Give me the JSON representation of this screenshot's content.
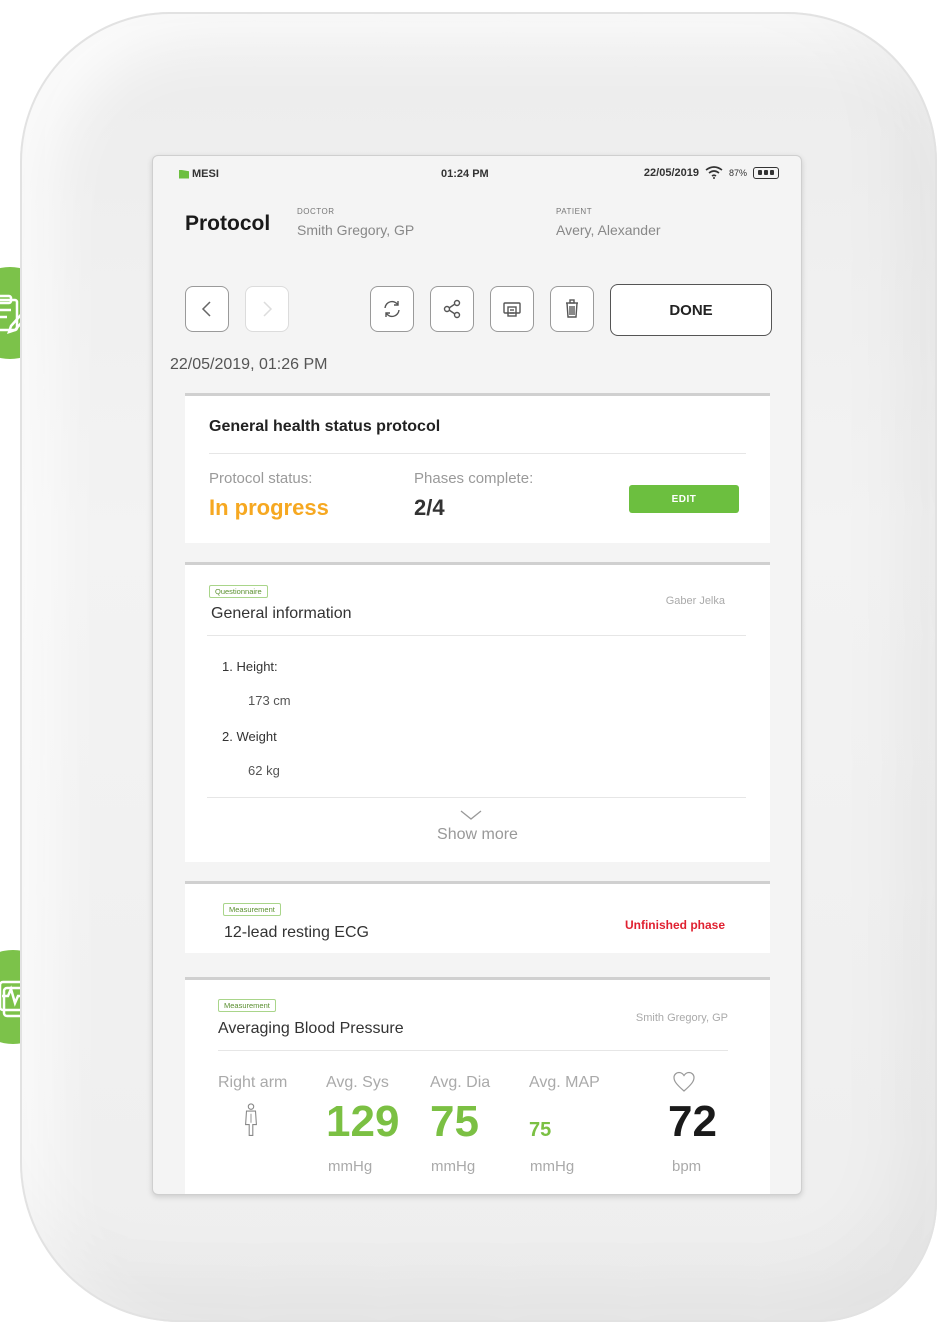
{
  "statusbar": {
    "brand": "MESI",
    "time": "01:24 PM",
    "date": "22/05/2019",
    "battery": "87%"
  },
  "header": {
    "title": "Protocol",
    "doctor_label": "DOCTOR",
    "doctor_name": "Smith Gregory, GP",
    "patient_label": "PATIENT",
    "patient_name": "Avery, Alexander"
  },
  "toolbar": {
    "done_label": "DONE"
  },
  "datetime": "22/05/2019, 01:26 PM",
  "protocol_card": {
    "title": "General health status protocol",
    "status_label": "Protocol status:",
    "status_value": "In progress",
    "phases_label": "Phases complete:",
    "phases_value": "2/4",
    "edit_label": "EDIT"
  },
  "questionnaire_card": {
    "tag": "Questionnaire",
    "title": "General information",
    "author": "Gaber Jelka",
    "questions": [
      {
        "label": "1. Height:",
        "value": "173 cm"
      },
      {
        "label": "2. Weight",
        "value": "62 kg"
      }
    ],
    "show_more": "Show more"
  },
  "ecg_card": {
    "tag": "Measurement",
    "title": "12-lead resting ECG",
    "status": "Unfinished phase"
  },
  "bp_card": {
    "tag": "Measurement",
    "title": "Averaging Blood Pressure",
    "author": "Smith Gregory, GP",
    "arm_label": "Right arm",
    "sys_label": "Avg. Sys",
    "dia_label": "Avg. Dia",
    "map_label": "Avg. MAP",
    "sys_value": "129",
    "dia_value": "75",
    "map_value": "75",
    "pulse_value": "72",
    "sys_unit": "mmHg",
    "dia_unit": "mmHg",
    "map_unit": "mmHg",
    "pulse_unit": "bpm"
  },
  "colors": {
    "accent_green": "#7cc24a",
    "status_orange": "#f6a821",
    "warning_red": "#e02030"
  },
  "icons": {
    "back": "chevron-left-icon",
    "forward": "chevron-right-icon",
    "refresh": "refresh-icon",
    "share": "share-icon",
    "print": "print-icon",
    "delete": "trash-icon",
    "bubble_top": "clipboard-edit-icon",
    "bubble_right": "share-icon",
    "bubble_bottom": "ecg-icon"
  }
}
